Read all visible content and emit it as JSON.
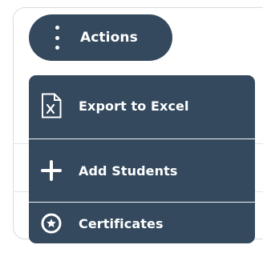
{
  "actions_button": {
    "label": "Actions",
    "icon": "kebab-vertical-icon"
  },
  "menu": {
    "items": [
      {
        "label": "Export to Excel",
        "icon": "excel-file-icon"
      },
      {
        "label": "Add Students",
        "icon": "plus-icon"
      },
      {
        "label": "Certificates",
        "icon": "certificate-badge-icon"
      }
    ]
  },
  "colors": {
    "primary": "#34495e",
    "text_on_primary": "#ffffff",
    "card_border": "#d7dbe0"
  }
}
